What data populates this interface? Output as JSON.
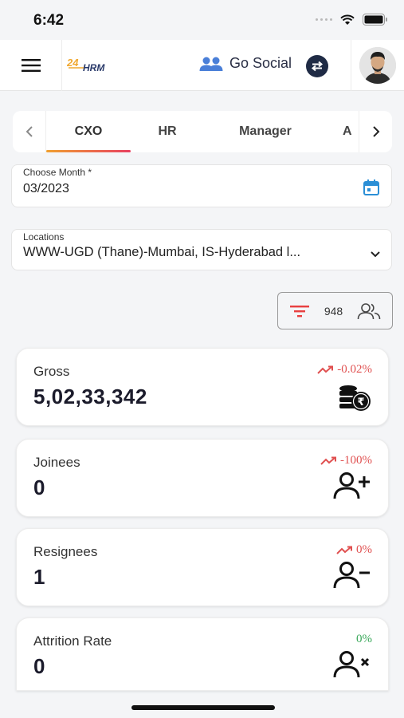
{
  "status_bar": {
    "time": "6:42"
  },
  "header": {
    "menu_icon": "hamburger-menu-icon",
    "logo_text": "24HRM",
    "go_social_label": "Go Social",
    "swap_icon": "swap-arrows-icon"
  },
  "tabs": {
    "items": [
      {
        "label": "CXO",
        "active": true
      },
      {
        "label": "HR",
        "active": false
      },
      {
        "label": "Manager",
        "active": false
      },
      {
        "label": "A",
        "active": false
      }
    ]
  },
  "month_field": {
    "label": "Choose Month *",
    "value": "03/2023"
  },
  "location_field": {
    "label": "Locations",
    "value": "WWW-UGD (Thane)-Mumbai, IS-Hyderabad l..."
  },
  "filter": {
    "count": "948"
  },
  "cards": [
    {
      "label": "Gross",
      "value": "5,02,33,342",
      "trend": "-0.02%",
      "trend_color": "#e05050",
      "icon": "rupee-coins-icon"
    },
    {
      "label": "Joinees",
      "value": "0",
      "trend": "-100%",
      "trend_color": "#e05050",
      "icon": "user-add-icon"
    },
    {
      "label": "Resignees",
      "value": "1",
      "trend": "0%",
      "trend_color": "#e05050",
      "icon": "user-remove-icon"
    },
    {
      "label": "Attrition Rate",
      "value": "0",
      "trend": "0%",
      "trend_color": "#3aa85a",
      "icon": "user-cross-icon"
    }
  ],
  "colors": {
    "accent": "#f0a030",
    "brand_dark": "#1f2b45",
    "calendar": "#2b8fd6",
    "filter_icon": "#e84040"
  }
}
